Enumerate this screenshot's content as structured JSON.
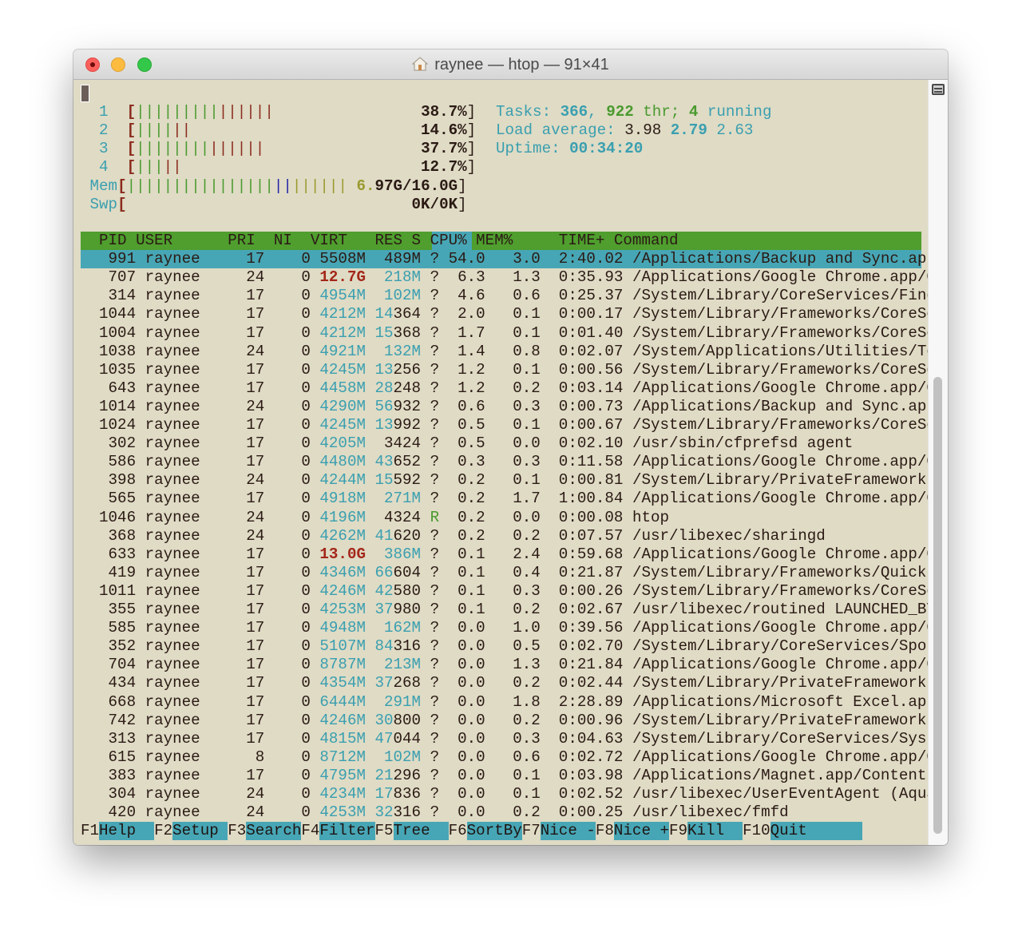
{
  "window": {
    "title": "raynee — htop — 91×41",
    "title_icon": "home-icon"
  },
  "meters": {
    "cpus": [
      {
        "label": "1",
        "percent": 38.7,
        "text": "38.7%",
        "normal_bars": 9,
        "kernel_bars": 6,
        "low_bars": 0
      },
      {
        "label": "2",
        "percent": 14.6,
        "text": "14.6%",
        "normal_bars": 4,
        "kernel_bars": 2,
        "low_bars": 0
      },
      {
        "label": "3",
        "percent": 37.7,
        "text": "37.7%",
        "normal_bars": 8,
        "kernel_bars": 6,
        "low_bars": 0
      },
      {
        "label": "4",
        "percent": 12.7,
        "text": "12.7%",
        "normal_bars": 3,
        "kernel_bars": 2,
        "low_bars": 0
      }
    ],
    "mem": {
      "label": "Mem",
      "used_bars": 16,
      "buffer_bars": 2,
      "cache_bars": 6,
      "text_prefix": "6.",
      "text": "97G/16.0G",
      "used": "6.97G",
      "total": "16.0G"
    },
    "swp": {
      "label": "Swp",
      "text": "0K/0K"
    }
  },
  "summary": {
    "tasks_label": "Tasks:",
    "tasks": "366",
    "threads": "922",
    "threads_label": "thr;",
    "running": "4",
    "running_label": "running",
    "load_label": "Load average:",
    "load1": "3.98",
    "load5": "2.79",
    "load15": "2.63",
    "uptime_label": "Uptime:",
    "uptime": "00:34:20"
  },
  "table": {
    "columns": [
      "PID",
      "USER",
      "PRI",
      "NI",
      "VIRT",
      "RES",
      "S",
      "CPU%",
      "MEM%",
      "TIME+",
      "Command"
    ],
    "sort_column": "CPU%",
    "rows": [
      {
        "pid": "991",
        "user": "raynee",
        "pri": "17",
        "ni": "0",
        "virt": "5508M",
        "res": "489M",
        "s": "?",
        "cpu": "54.0",
        "mem": "3.0",
        "time": "2:40.02",
        "cmd": "/Applications/Backup and Sync.app/",
        "selected": true
      },
      {
        "pid": "707",
        "user": "raynee",
        "pri": "24",
        "ni": "0",
        "virt": "12.7G",
        "res": "218M",
        "s": "?",
        "cpu": "6.3",
        "mem": "1.3",
        "time": "0:35.93",
        "cmd": "/Applications/Google Chrome.app/Co",
        "virt_large": true
      },
      {
        "pid": "314",
        "user": "raynee",
        "pri": "17",
        "ni": "0",
        "virt": "4954M",
        "res": "102M",
        "s": "?",
        "cpu": "4.6",
        "mem": "0.6",
        "time": "0:25.37",
        "cmd": "/System/Library/CoreServices/Finde"
      },
      {
        "pid": "1044",
        "user": "raynee",
        "pri": "17",
        "ni": "0",
        "virt": "4212M",
        "res": "14364",
        "s": "?",
        "cpu": "2.0",
        "mem": "0.1",
        "time": "0:00.17",
        "cmd": "/System/Library/Frameworks/CoreSer"
      },
      {
        "pid": "1004",
        "user": "raynee",
        "pri": "17",
        "ni": "0",
        "virt": "4212M",
        "res": "15368",
        "s": "?",
        "cpu": "1.7",
        "mem": "0.1",
        "time": "0:01.40",
        "cmd": "/System/Library/Frameworks/CoreSer"
      },
      {
        "pid": "1038",
        "user": "raynee",
        "pri": "24",
        "ni": "0",
        "virt": "4921M",
        "res": "132M",
        "s": "?",
        "cpu": "1.4",
        "mem": "0.8",
        "time": "0:02.07",
        "cmd": "/System/Applications/Utilities/Ter"
      },
      {
        "pid": "1035",
        "user": "raynee",
        "pri": "17",
        "ni": "0",
        "virt": "4245M",
        "res": "13256",
        "s": "?",
        "cpu": "1.2",
        "mem": "0.1",
        "time": "0:00.56",
        "cmd": "/System/Library/Frameworks/CoreSer"
      },
      {
        "pid": "643",
        "user": "raynee",
        "pri": "17",
        "ni": "0",
        "virt": "4458M",
        "res": "28248",
        "s": "?",
        "cpu": "1.2",
        "mem": "0.2",
        "time": "0:03.14",
        "cmd": "/Applications/Google Chrome.app/Co"
      },
      {
        "pid": "1014",
        "user": "raynee",
        "pri": "24",
        "ni": "0",
        "virt": "4290M",
        "res": "56932",
        "s": "?",
        "cpu": "0.6",
        "mem": "0.3",
        "time": "0:00.73",
        "cmd": "/Applications/Backup and Sync.app/"
      },
      {
        "pid": "1024",
        "user": "raynee",
        "pri": "17",
        "ni": "0",
        "virt": "4245M",
        "res": "13992",
        "s": "?",
        "cpu": "0.5",
        "mem": "0.1",
        "time": "0:00.67",
        "cmd": "/System/Library/Frameworks/CoreSer"
      },
      {
        "pid": "302",
        "user": "raynee",
        "pri": "17",
        "ni": "0",
        "virt": "4205M",
        "res": "3424",
        "s": "?",
        "cpu": "0.5",
        "mem": "0.0",
        "time": "0:02.10",
        "cmd": "/usr/sbin/cfprefsd agent"
      },
      {
        "pid": "586",
        "user": "raynee",
        "pri": "17",
        "ni": "0",
        "virt": "4480M",
        "res": "43652",
        "s": "?",
        "cpu": "0.3",
        "mem": "0.3",
        "time": "0:11.58",
        "cmd": "/Applications/Google Chrome.app/Co"
      },
      {
        "pid": "398",
        "user": "raynee",
        "pri": "24",
        "ni": "0",
        "virt": "4244M",
        "res": "15592",
        "s": "?",
        "cpu": "0.2",
        "mem": "0.1",
        "time": "0:00.81",
        "cmd": "/System/Library/PrivateFrameworks/"
      },
      {
        "pid": "565",
        "user": "raynee",
        "pri": "17",
        "ni": "0",
        "virt": "4918M",
        "res": "271M",
        "s": "?",
        "cpu": "0.2",
        "mem": "1.7",
        "time": "1:00.84",
        "cmd": "/Applications/Google Chrome.app/Co"
      },
      {
        "pid": "1046",
        "user": "raynee",
        "pri": "24",
        "ni": "0",
        "virt": "4196M",
        "res": "4324",
        "s": "R",
        "cpu": "0.2",
        "mem": "0.0",
        "time": "0:00.08",
        "cmd": "htop"
      },
      {
        "pid": "368",
        "user": "raynee",
        "pri": "24",
        "ni": "0",
        "virt": "4262M",
        "res": "41620",
        "s": "?",
        "cpu": "0.2",
        "mem": "0.2",
        "time": "0:07.57",
        "cmd": "/usr/libexec/sharingd"
      },
      {
        "pid": "633",
        "user": "raynee",
        "pri": "17",
        "ni": "0",
        "virt": "13.0G",
        "res": "386M",
        "s": "?",
        "cpu": "0.1",
        "mem": "2.4",
        "time": "0:59.68",
        "cmd": "/Applications/Google Chrome.app/Co",
        "virt_large": true
      },
      {
        "pid": "419",
        "user": "raynee",
        "pri": "17",
        "ni": "0",
        "virt": "4346M",
        "res": "66604",
        "s": "?",
        "cpu": "0.1",
        "mem": "0.4",
        "time": "0:21.87",
        "cmd": "/System/Library/Frameworks/QuickLo"
      },
      {
        "pid": "1011",
        "user": "raynee",
        "pri": "17",
        "ni": "0",
        "virt": "4246M",
        "res": "42580",
        "s": "?",
        "cpu": "0.1",
        "mem": "0.3",
        "time": "0:00.26",
        "cmd": "/System/Library/Frameworks/CoreSer"
      },
      {
        "pid": "355",
        "user": "raynee",
        "pri": "17",
        "ni": "0",
        "virt": "4253M",
        "res": "37980",
        "s": "?",
        "cpu": "0.1",
        "mem": "0.2",
        "time": "0:02.67",
        "cmd": "/usr/libexec/routined LAUNCHED_BY_"
      },
      {
        "pid": "585",
        "user": "raynee",
        "pri": "17",
        "ni": "0",
        "virt": "4948M",
        "res": "162M",
        "s": "?",
        "cpu": "0.0",
        "mem": "1.0",
        "time": "0:39.56",
        "cmd": "/Applications/Google Chrome.app/Co"
      },
      {
        "pid": "352",
        "user": "raynee",
        "pri": "17",
        "ni": "0",
        "virt": "5107M",
        "res": "84316",
        "s": "?",
        "cpu": "0.0",
        "mem": "0.5",
        "time": "0:02.70",
        "cmd": "/System/Library/CoreServices/Spotl"
      },
      {
        "pid": "704",
        "user": "raynee",
        "pri": "17",
        "ni": "0",
        "virt": "8787M",
        "res": "213M",
        "s": "?",
        "cpu": "0.0",
        "mem": "1.3",
        "time": "0:21.84",
        "cmd": "/Applications/Google Chrome.app/Co"
      },
      {
        "pid": "434",
        "user": "raynee",
        "pri": "17",
        "ni": "0",
        "virt": "4354M",
        "res": "37268",
        "s": "?",
        "cpu": "0.0",
        "mem": "0.2",
        "time": "0:02.44",
        "cmd": "/System/Library/PrivateFrameworks/"
      },
      {
        "pid": "668",
        "user": "raynee",
        "pri": "17",
        "ni": "0",
        "virt": "6444M",
        "res": "291M",
        "s": "?",
        "cpu": "0.0",
        "mem": "1.8",
        "time": "2:28.89",
        "cmd": "/Applications/Microsoft Excel.app/"
      },
      {
        "pid": "742",
        "user": "raynee",
        "pri": "17",
        "ni": "0",
        "virt": "4246M",
        "res": "30800",
        "s": "?",
        "cpu": "0.0",
        "mem": "0.2",
        "time": "0:00.96",
        "cmd": "/System/Library/PrivateFrameworks/"
      },
      {
        "pid": "313",
        "user": "raynee",
        "pri": "17",
        "ni": "0",
        "virt": "4815M",
        "res": "47044",
        "s": "?",
        "cpu": "0.0",
        "mem": "0.3",
        "time": "0:04.63",
        "cmd": "/System/Library/CoreServices/Syste"
      },
      {
        "pid": "615",
        "user": "raynee",
        "pri": "8",
        "ni": "0",
        "virt": "8712M",
        "res": "102M",
        "s": "?",
        "cpu": "0.0",
        "mem": "0.6",
        "time": "0:02.72",
        "cmd": "/Applications/Google Chrome.app/Co"
      },
      {
        "pid": "383",
        "user": "raynee",
        "pri": "17",
        "ni": "0",
        "virt": "4795M",
        "res": "21296",
        "s": "?",
        "cpu": "0.0",
        "mem": "0.1",
        "time": "0:03.98",
        "cmd": "/Applications/Magnet.app/Contents/"
      },
      {
        "pid": "304",
        "user": "raynee",
        "pri": "24",
        "ni": "0",
        "virt": "4234M",
        "res": "17836",
        "s": "?",
        "cpu": "0.0",
        "mem": "0.1",
        "time": "0:02.52",
        "cmd": "/usr/libexec/UserEventAgent (Aqua)"
      },
      {
        "pid": "420",
        "user": "raynee",
        "pri": "24",
        "ni": "0",
        "virt": "4253M",
        "res": "32316",
        "s": "?",
        "cpu": "0.0",
        "mem": "0.2",
        "time": "0:00.25",
        "cmd": "/usr/libexec/fmfd"
      }
    ]
  },
  "footer": {
    "keys": [
      {
        "key": "F1",
        "label": "Help  "
      },
      {
        "key": "F2",
        "label": "Setup "
      },
      {
        "key": "F3",
        "label": "Search"
      },
      {
        "key": "F4",
        "label": "Filter"
      },
      {
        "key": "F5",
        "label": "Tree  "
      },
      {
        "key": "F6",
        "label": "SortBy"
      },
      {
        "key": "F7",
        "label": "Nice -"
      },
      {
        "key": "F8",
        "label": "Nice +"
      },
      {
        "key": "F9",
        "label": "Kill  "
      },
      {
        "key": "F10",
        "label": "Quit  "
      }
    ]
  },
  "colors": {
    "background": "#dfdbc5",
    "header_bg": "#4f9e2e",
    "selection_bg": "#47a6b5",
    "cyan": "#3a9fb0",
    "green": "#4a9a2e",
    "red": "#8b2a1c",
    "blue": "#2424a8",
    "olive": "#9a9a2e"
  }
}
